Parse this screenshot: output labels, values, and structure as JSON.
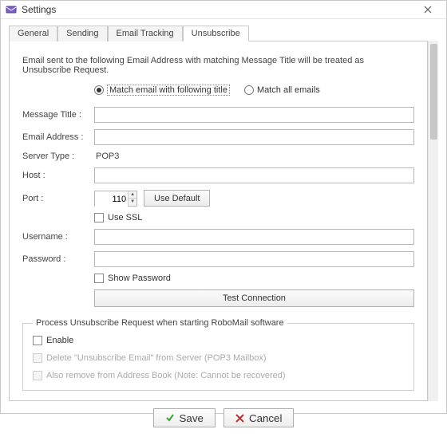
{
  "window": {
    "title": "Settings"
  },
  "tabs": {
    "general": "General",
    "sending": "Sending",
    "email_tracking": "Email Tracking",
    "unsubscribe": "Unsubscribe"
  },
  "intro": "Email sent to the following Email Address with matching Message Title will be treated as Unsubscribe Request.",
  "radios": {
    "match_title": "Match email with following title",
    "match_all": "Match all emails"
  },
  "labels": {
    "message_title": "Message Title :",
    "email_address": "Email Address :",
    "server_type": "Server Type :",
    "host": "Host :",
    "port": "Port :",
    "username": "Username :",
    "password": "Password :"
  },
  "values": {
    "message_title": "",
    "email_address": "",
    "server_type": "POP3",
    "host": "",
    "port": "110",
    "username": "",
    "password": ""
  },
  "buttons": {
    "use_default": "Use Default",
    "test_connection": "Test Connection",
    "save": "Save",
    "cancel": "Cancel"
  },
  "checks": {
    "use_ssl": "Use SSL",
    "show_password": "Show Password",
    "enable": "Enable",
    "delete_from_server": "Delete \"Unsubscribe Email\" from Server (POP3 Mailbox)",
    "remove_from_book": "Also remove from Address Book (Note: Cannot be recovered)"
  },
  "fieldset_legend": "Process Unsubscribe Request when starting RoboMail software"
}
